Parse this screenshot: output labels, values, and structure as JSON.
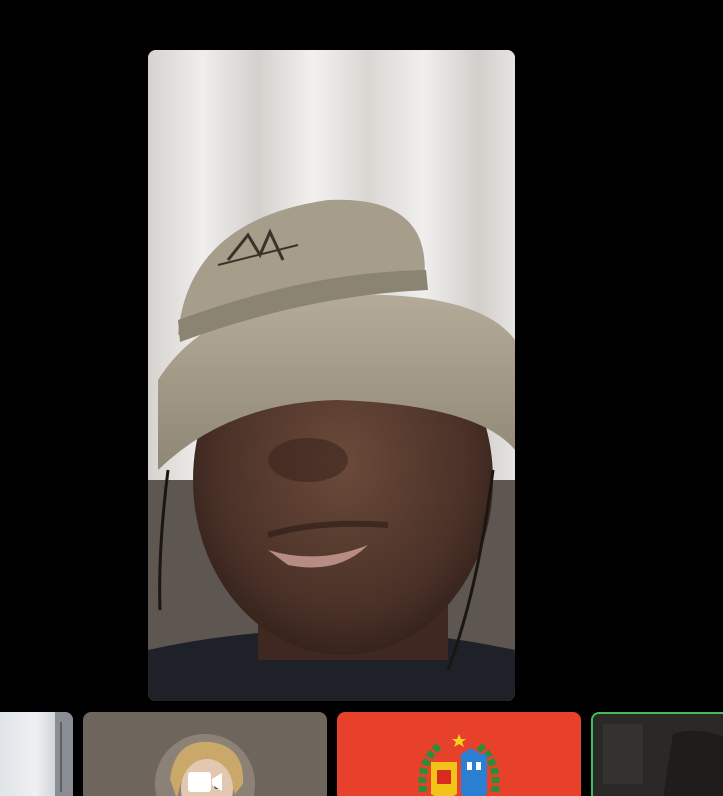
{
  "call": {
    "main_participant": {
      "video": "self-view-camera-feed"
    },
    "thumbnails": [
      {
        "kind": "video-feed"
      },
      {
        "kind": "avatar",
        "icon": "video-camera-icon"
      },
      {
        "kind": "emblem-avatar"
      },
      {
        "kind": "video-feed",
        "active_speaker": true
      }
    ]
  },
  "colors": {
    "background": "#000000",
    "tile_neutral": "#6e655c",
    "tile_red": "#e8412b",
    "active_border": "#3fbf5a"
  }
}
